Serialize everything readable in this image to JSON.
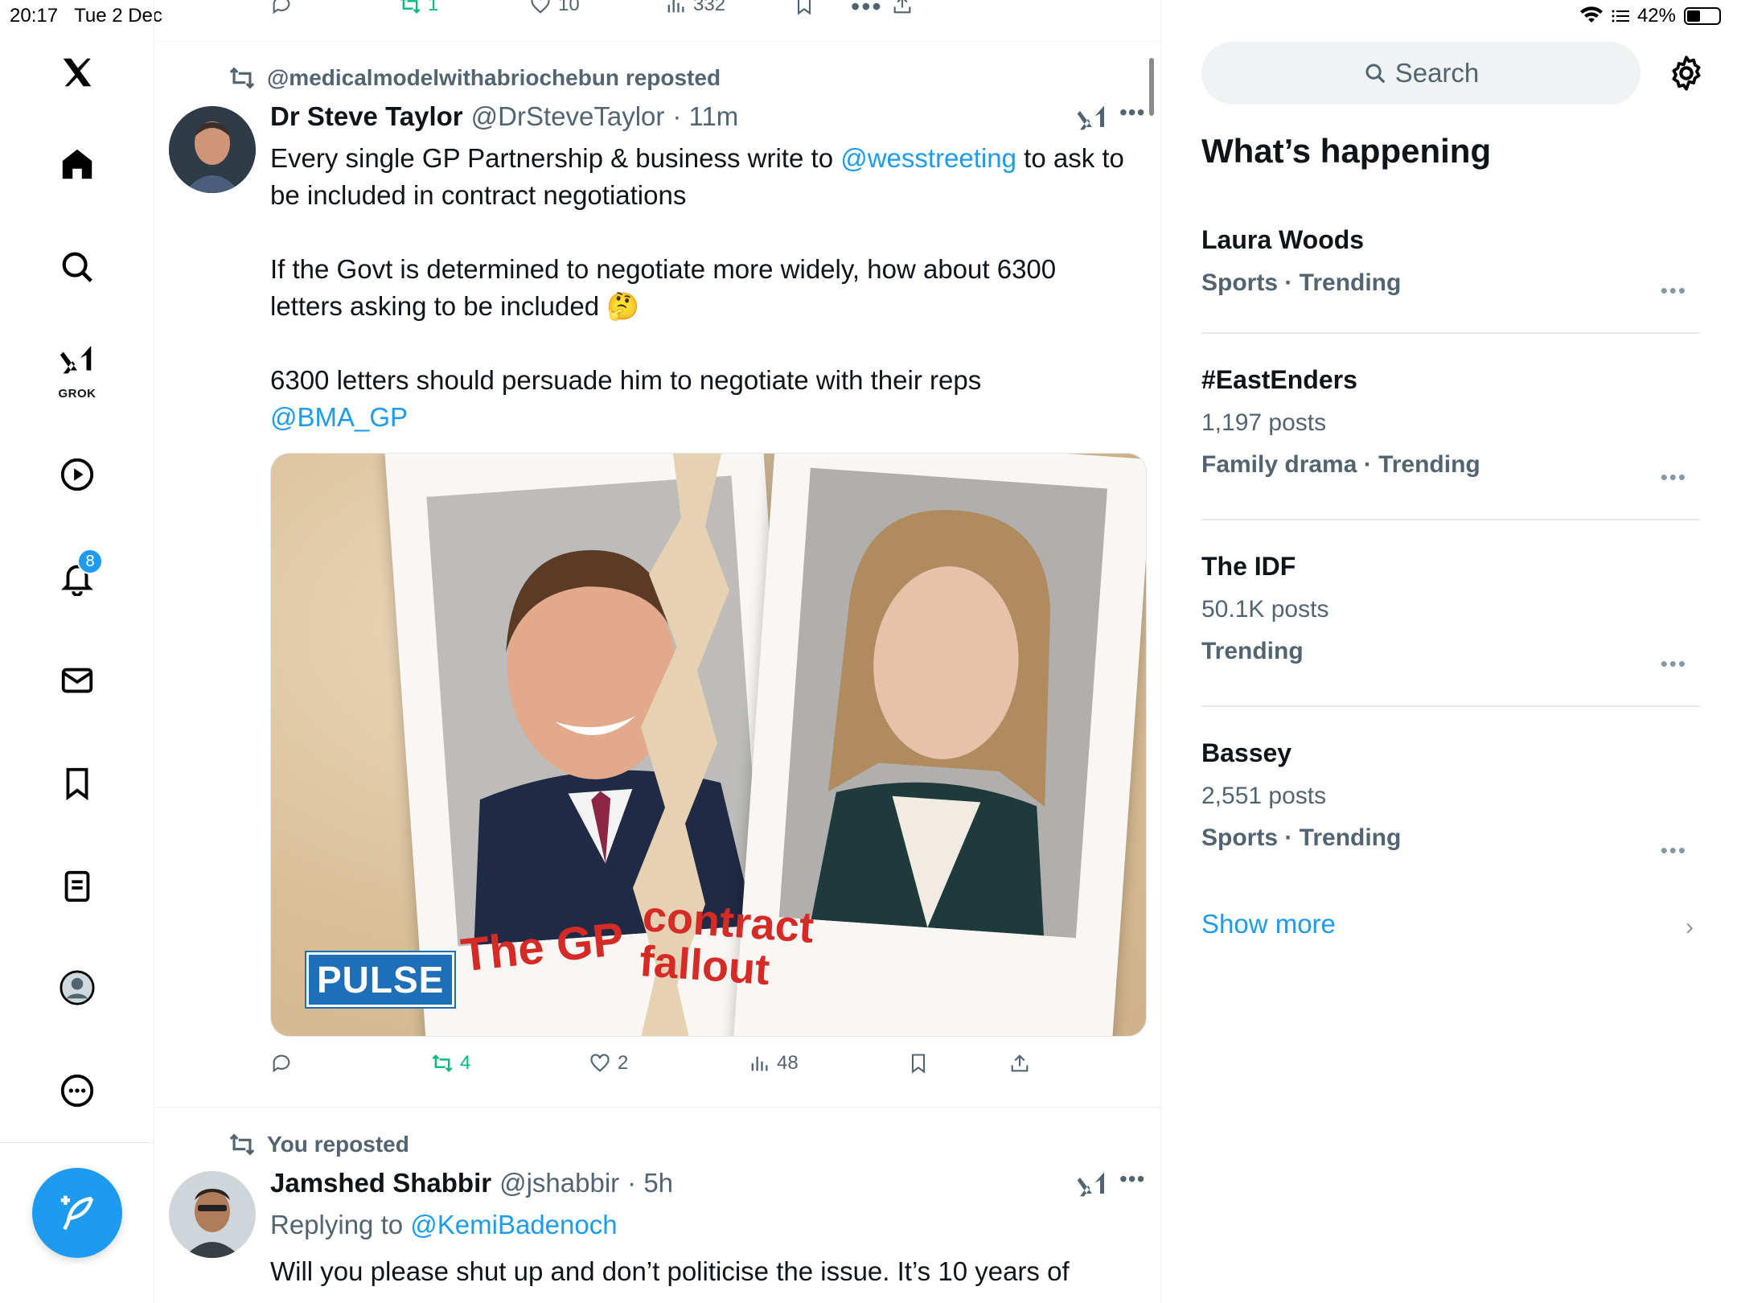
{
  "status_bar": {
    "time": "20:17",
    "date": "Tue 2 Dec",
    "battery": "42%"
  },
  "nav": {
    "grok_label": "GROK",
    "notifications_badge": "8"
  },
  "top_tweet_actions": {
    "retweets": "1",
    "likes": "10",
    "views": "332"
  },
  "tweet1": {
    "reposted_by": "@medicalmodelwithabriochebun reposted",
    "name": "Dr Steve Taylor",
    "handle": "@DrSteveTaylor",
    "time": "· 11m",
    "text1_a": "Every single GP Partnership & business write to ",
    "text1_mention": "@wesstreeting",
    "text1_b": " to ask to be included in contract negotiations",
    "text2": "If the Govt is determined to negotiate more widely, how about 6300 letters asking to be included 🤔",
    "text3": "6300 letters should persuade him to negotiate with their reps",
    "text3_mention": "@BMA_GP",
    "image": {
      "pulse_logo": "PULSE",
      "left_caption": "The GP",
      "right_caption": "contract fallout"
    },
    "actions": {
      "retweets": "4",
      "likes": "2",
      "views": "48"
    }
  },
  "tweet2": {
    "reposted_by": "You reposted",
    "name": "Jamshed Shabbir",
    "handle": "@jshabbir",
    "time": "· 5h",
    "replying_prefix": "Replying to ",
    "replying_to": "@KemiBadenoch",
    "text": "Will you please shut up and don’t politicise the issue. It’s 10 years of"
  },
  "sidebar": {
    "search_placeholder": "Search",
    "section_title": "What’s happening",
    "trends": [
      {
        "name": "Laura Woods",
        "posts": "",
        "meta": "Sports · Trending"
      },
      {
        "name": "#EastEnders",
        "posts": "1,197 posts",
        "meta": "Family drama · Trending"
      },
      {
        "name": "The IDF",
        "posts": "50.1K posts",
        "meta": "Trending"
      },
      {
        "name": "Bassey",
        "posts": "2,551 posts",
        "meta": "Sports · Trending"
      }
    ],
    "show_more": "Show more"
  },
  "colors": {
    "accent": "#1d9bf0",
    "retweet_green": "#00ba7c",
    "secondary_text": "#536471",
    "pulse_blue": "#1e6fb8",
    "headline_red": "#d52a25"
  }
}
